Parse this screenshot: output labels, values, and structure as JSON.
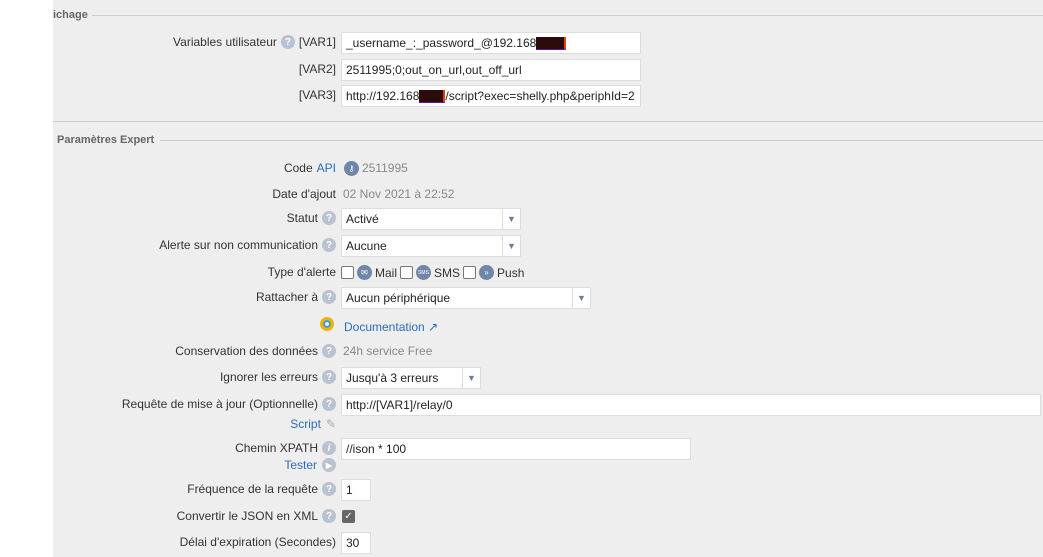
{
  "sections": {
    "display": "ichage",
    "expert": "Paramètres Expert"
  },
  "vars": {
    "label": "Variables utilisateur",
    "items": [
      {
        "tag": "[VAR1]",
        "before": "_username_:_password_@192.168",
        "after": ""
      },
      {
        "tag": "[VAR2]",
        "before": "2511995;0;out_on_url,out_off_url",
        "after": ""
      },
      {
        "tag": "[VAR3]",
        "before": "http://192.168",
        "after": "/script?exec=shelly.php&periphId=2"
      }
    ]
  },
  "code_api": {
    "label": "Code",
    "link": "API",
    "value": "2511995"
  },
  "date_ajout": {
    "label": "Date d'ajout",
    "value": "02 Nov 2021 à 22:52"
  },
  "statut": {
    "label": "Statut",
    "value": "Activé"
  },
  "alerte": {
    "label": "Alerte sur non communication",
    "value": "Aucune"
  },
  "type_alerte": {
    "label": "Type d'alerte",
    "mail": "Mail",
    "sms": "SMS",
    "push": "Push",
    "sms_icon_text": "SMS"
  },
  "rattacher": {
    "label": "Rattacher à",
    "value": "Aucun périphérique"
  },
  "documentation": "Documentation",
  "conservation": {
    "label": "Conservation des données",
    "value": "24h service Free"
  },
  "ignorer": {
    "label": "Ignorer les erreurs",
    "value": "Jusqu'à 3 erreurs"
  },
  "requete": {
    "label": "Requête de mise à jour (Optionnelle)",
    "value": "http://[VAR1]/relay/0",
    "script": "Script"
  },
  "xpath": {
    "label": "Chemin XPATH",
    "value": "//ison * 100",
    "tester": "Tester"
  },
  "frequence": {
    "label": "Fréquence de la requête",
    "value": "1"
  },
  "convertir": {
    "label": "Convertir le JSON en XML",
    "checked": true
  },
  "delai": {
    "label": "Délai d'expiration (Secondes)",
    "value": "30"
  }
}
